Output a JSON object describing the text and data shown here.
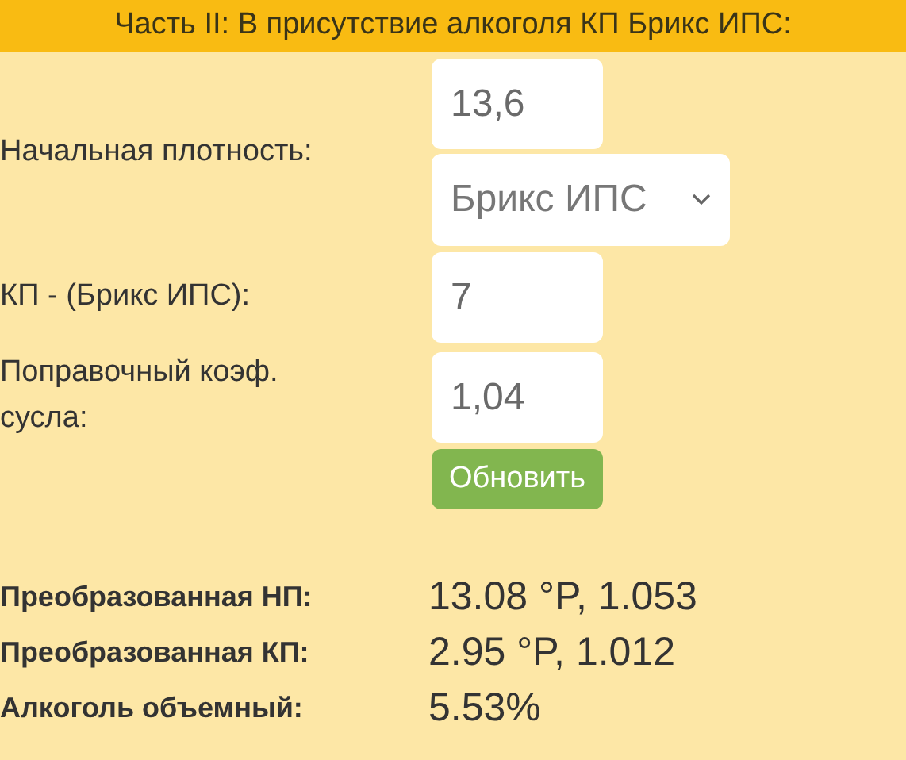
{
  "header": {
    "title": "Часть II: В присутствие алкоголя КП Брикс ИПС:"
  },
  "fields": [
    {
      "kind": "input-select",
      "label": "Начальная плотность:",
      "value": "13,6",
      "select": "Брикс ИПС"
    },
    {
      "kind": "input",
      "label": "КП - (Брикс ИПС):",
      "value": "7"
    },
    {
      "kind": "input",
      "label": "Поправочный коэф. сусла:",
      "value": "1,04"
    }
  ],
  "button": {
    "label": "Обновить"
  },
  "results": [
    {
      "label": "Преобразованная НП:",
      "value": "13.08 °P, 1.053"
    },
    {
      "label": "Преобразованная КП:",
      "value": "2.95 °P, 1.012"
    },
    {
      "label": "Алкоголь объемный:",
      "value": "5.53%"
    }
  ]
}
